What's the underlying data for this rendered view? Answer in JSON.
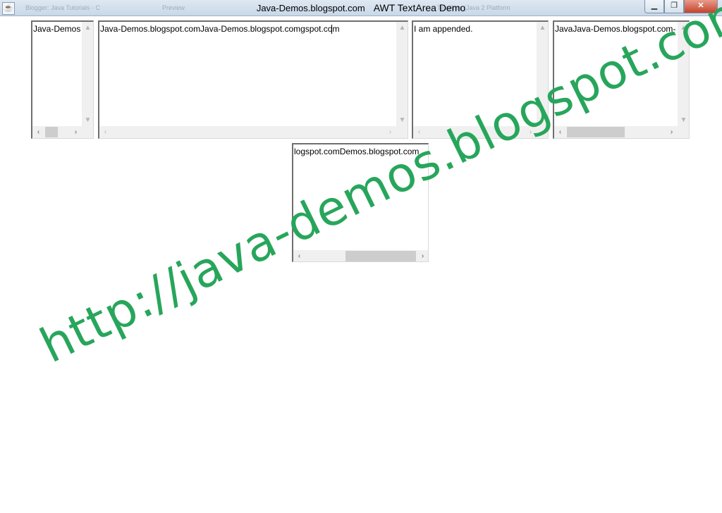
{
  "window": {
    "blog_title": "Java-Demos.blogspot.com",
    "title": "AWT TextArea Demo",
    "background_tabs": [
      "Blogger: Java Tutorials - C",
      "Preview",
      "TextArea (Java 2 Platform"
    ],
    "controls": {
      "minimize": "▁",
      "restore": "❐",
      "close": "✕"
    }
  },
  "textareas": [
    {
      "id": "ta1",
      "text": "Java-Demos",
      "has_vscroll": true,
      "has_hscroll": true
    },
    {
      "id": "ta2",
      "text": "Java-Demos.blogspot.comJava-Demos.blogspot.comgspot.com",
      "has_vscroll": true,
      "has_hscroll": true
    },
    {
      "id": "ta3",
      "text": "I am appended.",
      "has_vscroll": true,
      "has_hscroll": true
    },
    {
      "id": "ta4",
      "text": "JavaJava-Demos.blogspot.com-",
      "has_vscroll": true,
      "has_hscroll": true
    },
    {
      "id": "ta5",
      "text": "logspot.comDemos.blogspot.com",
      "has_vscroll": false,
      "has_hscroll": true
    }
  ],
  "scroll_glyphs": {
    "up": "▲",
    "down": "▼",
    "left": "‹",
    "right": "›"
  },
  "watermark": {
    "text": "http://java-demos.blogspot.com",
    "color": "#27a65b"
  },
  "colors": {
    "accent": "#27a65b",
    "titlebar": "#d4e0ec",
    "close_button": "#c4432b"
  }
}
